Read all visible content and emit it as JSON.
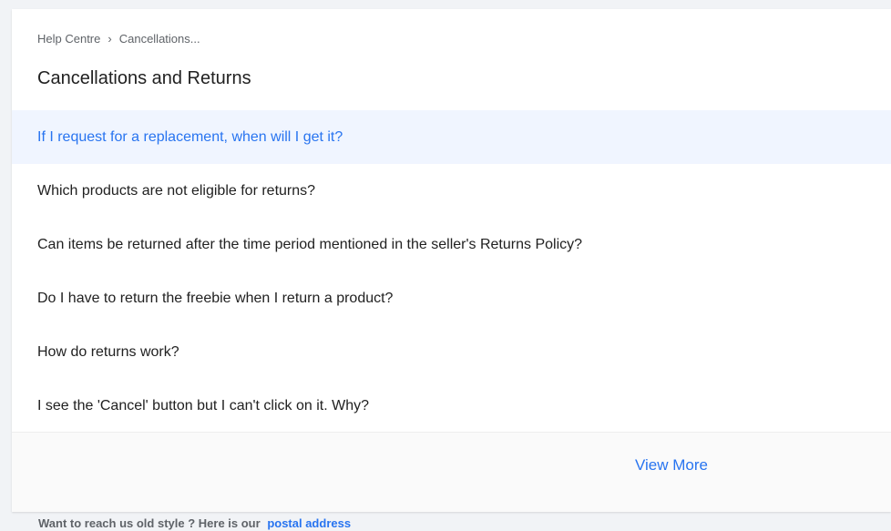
{
  "breadcrumb": {
    "home": "Help Centre",
    "separator": "›",
    "current": "Cancellations..."
  },
  "page": {
    "title": "Cancellations and Returns"
  },
  "faq": {
    "items": [
      {
        "label": "If I request for a replacement, when will I get it?"
      },
      {
        "label": "Which products are not eligible for returns?"
      },
      {
        "label": "Can items be returned after the time period mentioned in the seller's Returns Policy?"
      },
      {
        "label": "Do I have to return the freebie when I return a product?"
      },
      {
        "label": "How do returns work?"
      },
      {
        "label": "I see the 'Cancel' button but I can't click on it. Why?"
      }
    ],
    "view_more": "View More"
  },
  "contact": {
    "text": "Want to reach us old style ? Here is our",
    "link": "postal address"
  },
  "colors": {
    "accent": "#2874f0",
    "active_bg": "#f0f5ff",
    "page_bg": "#f1f3f6"
  }
}
